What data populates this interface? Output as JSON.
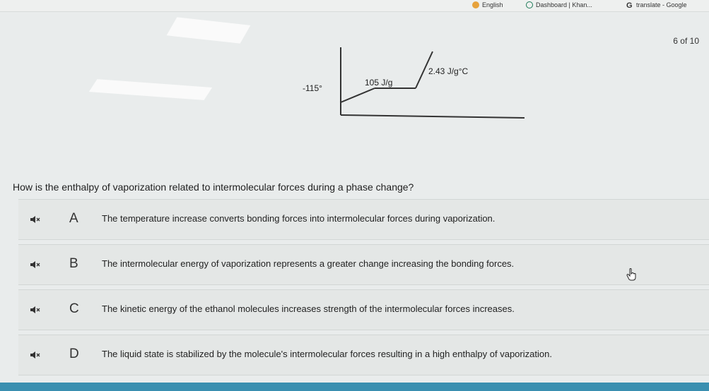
{
  "bookmarks": [
    {
      "label": "English",
      "icon": "english-flag-icon"
    },
    {
      "label": "Dashboard | Khan...",
      "icon": "khan-academy-icon"
    },
    {
      "label": "translate - Google",
      "icon": "google-g-icon"
    }
  ],
  "progress": "6 of 10",
  "graph": {
    "temp_label": "-115°",
    "heat_fusion": "105 J/g",
    "specific_heat": "2.43 J/g°C"
  },
  "question": "How is the enthalpy of vaporization related to intermolecular forces during a phase change?",
  "choices": [
    {
      "letter": "A",
      "text": "The temperature increase converts bonding forces into intermolecular forces during vaporization."
    },
    {
      "letter": "B",
      "text": "The intermolecular energy of vaporization represents a greater change increasing the bonding forces."
    },
    {
      "letter": "C",
      "text": "The kinetic energy of the ethanol molecules increases strength of the intermolecular forces increases."
    },
    {
      "letter": "D",
      "text": "The liquid state is stabilized by the molecule's intermolecular forces resulting in a high enthalpy of vaporization."
    }
  ],
  "colors": {
    "background": "#e9ecec",
    "bottom_bar": "#3a8fb0"
  }
}
